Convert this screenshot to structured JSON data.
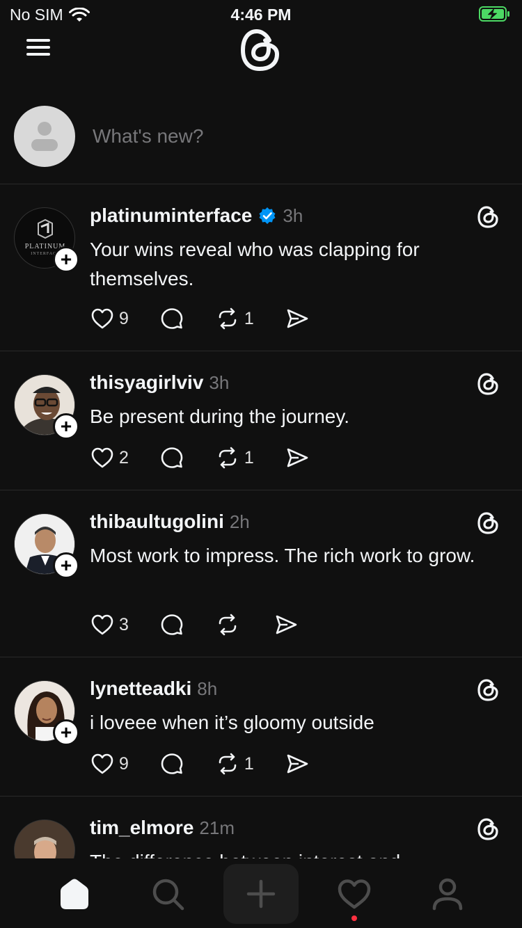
{
  "status_bar": {
    "carrier": "No SIM",
    "time": "4:46 PM"
  },
  "composer": {
    "placeholder": "What's new?"
  },
  "posts": [
    {
      "username": "platinuminterface",
      "verified": true,
      "time": "3h",
      "text": "Your wins reveal who was clapping for themselves.",
      "likes": "9",
      "replies": "",
      "reposts": "1",
      "avatar_label": "PLATINUM INTERFACE"
    },
    {
      "username": "thisyagirlviv",
      "verified": false,
      "time": "3h",
      "text": "Be present during the journey.",
      "likes": "2",
      "replies": "",
      "reposts": "1"
    },
    {
      "username": "thibaultugolini",
      "verified": false,
      "time": "2h",
      "text": "Most work to impress. The rich work to grow.",
      "likes": "3",
      "replies": "",
      "reposts": ""
    },
    {
      "username": "lynetteadki",
      "verified": false,
      "time": "8h",
      "text": "i loveee when it’s gloomy outside",
      "likes": "9",
      "replies": "",
      "reposts": "1"
    },
    {
      "username": "tim_elmore",
      "verified": false,
      "time": "21m",
      "text": "The difference between interest and"
    }
  ],
  "tabs": [
    "home-icon",
    "search-icon",
    "new-thread-icon",
    "activity-icon",
    "profile-icon"
  ],
  "colors": {
    "background": "#101010",
    "text": "#f3f5f7",
    "muted": "#77777a",
    "verified": "#0095f6",
    "notification": "#ff3040",
    "battery": "#4cd964"
  }
}
